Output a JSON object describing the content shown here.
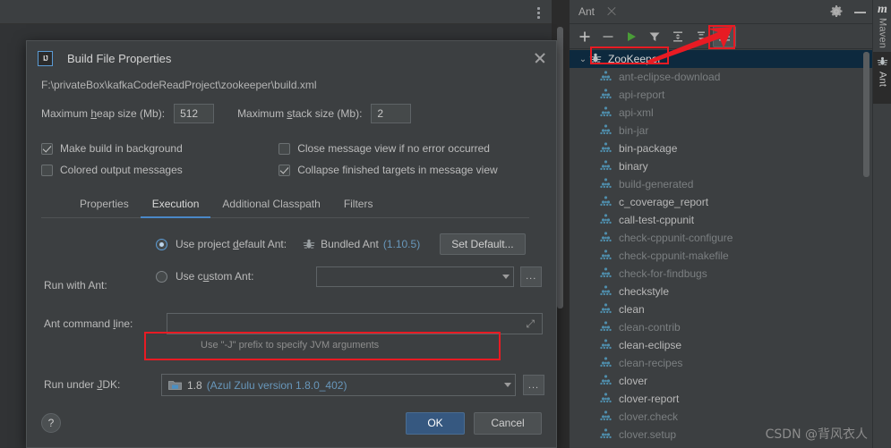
{
  "dialog": {
    "title": "Build File Properties",
    "logo_text": "IJ",
    "file_path": "F:\\privateBox\\kafkaCodeReadProject\\zookeeper\\build.xml",
    "max_heap_label": "Maximum heap size (Mb):",
    "max_heap_value": "512",
    "max_stack_label": "Maximum stack size (Mb):",
    "max_stack_value": "2",
    "checkboxes": [
      {
        "label": "Make build in background",
        "checked": true
      },
      {
        "label": "Close message view if no error occurred",
        "checked": false
      },
      {
        "label": "Colored output messages",
        "checked": false
      },
      {
        "label": "Collapse finished targets in message view",
        "checked": true
      }
    ],
    "tabs": [
      {
        "label": "Properties",
        "active": false
      },
      {
        "label": "Execution",
        "active": true
      },
      {
        "label": "Additional Classpath",
        "active": false
      },
      {
        "label": "Filters",
        "active": false
      }
    ],
    "execution": {
      "run_with_ant_label": "Run with Ant:",
      "use_default_label": "Use project default Ant:",
      "use_default_selected": true,
      "bundled_ant_name": "Bundled Ant",
      "bundled_ant_version": "(1.10.5)",
      "set_default_button": "Set Default...",
      "use_custom_label": "Use custom Ant:",
      "use_custom_selected": false,
      "custom_ant_value": "",
      "browse_button": "...",
      "command_line_label": "Ant command line:",
      "command_line_value": "",
      "command_line_hint": "Use \"-J\" prefix to specify JVM arguments",
      "jdk_label": "Run under JDK:",
      "jdk_value_name": "1.8",
      "jdk_value_detail": "(Azul Zulu version 1.8.0_402)"
    },
    "footer": {
      "help_label": "?",
      "ok_label": "OK",
      "cancel_label": "Cancel"
    }
  },
  "ant_tool_window": {
    "tab_title": "Ant",
    "toolbar": [
      {
        "name": "add",
        "glyph": "+"
      },
      {
        "name": "remove",
        "glyph": "−"
      },
      {
        "name": "run",
        "glyph": "▶"
      },
      {
        "name": "filter",
        "glyph": "▼"
      },
      {
        "name": "expand-all",
        "glyph": "≡"
      },
      {
        "name": "collapse-all",
        "glyph": "≡"
      },
      {
        "name": "properties",
        "glyph": "☰"
      }
    ],
    "root": {
      "label": "ZooKeeper",
      "expanded": true
    },
    "targets": [
      {
        "label": "ant-eclipse-download",
        "dim": true
      },
      {
        "label": "api-report",
        "dim": true
      },
      {
        "label": "api-xml",
        "dim": true
      },
      {
        "label": "bin-jar",
        "dim": true
      },
      {
        "label": "bin-package",
        "dim": false
      },
      {
        "label": "binary",
        "dim": false
      },
      {
        "label": "build-generated",
        "dim": true
      },
      {
        "label": "c_coverage_report",
        "dim": false
      },
      {
        "label": "call-test-cppunit",
        "dim": false
      },
      {
        "label": "check-cppunit-configure",
        "dim": true
      },
      {
        "label": "check-cppunit-makefile",
        "dim": true
      },
      {
        "label": "check-for-findbugs",
        "dim": true
      },
      {
        "label": "checkstyle",
        "dim": false
      },
      {
        "label": "clean",
        "dim": false
      },
      {
        "label": "clean-contrib",
        "dim": true
      },
      {
        "label": "clean-eclipse",
        "dim": false
      },
      {
        "label": "clean-recipes",
        "dim": true
      },
      {
        "label": "clover",
        "dim": false
      },
      {
        "label": "clover-report",
        "dim": false
      },
      {
        "label": "clover.check",
        "dim": true
      },
      {
        "label": "clover.setup",
        "dim": true
      }
    ]
  },
  "side_tabs": [
    {
      "label": "Maven",
      "icon": "maven-m-icon",
      "active": false
    },
    {
      "label": "Ant",
      "icon": "ant-bug-icon",
      "active": true
    }
  ],
  "watermark": "CSDN @背风衣人",
  "colors": {
    "accent": "#4a88c7",
    "annotation_red": "#e81b23",
    "link_blue": "#6897bb",
    "ok_button": "#365880",
    "selection": "#0d293e"
  }
}
